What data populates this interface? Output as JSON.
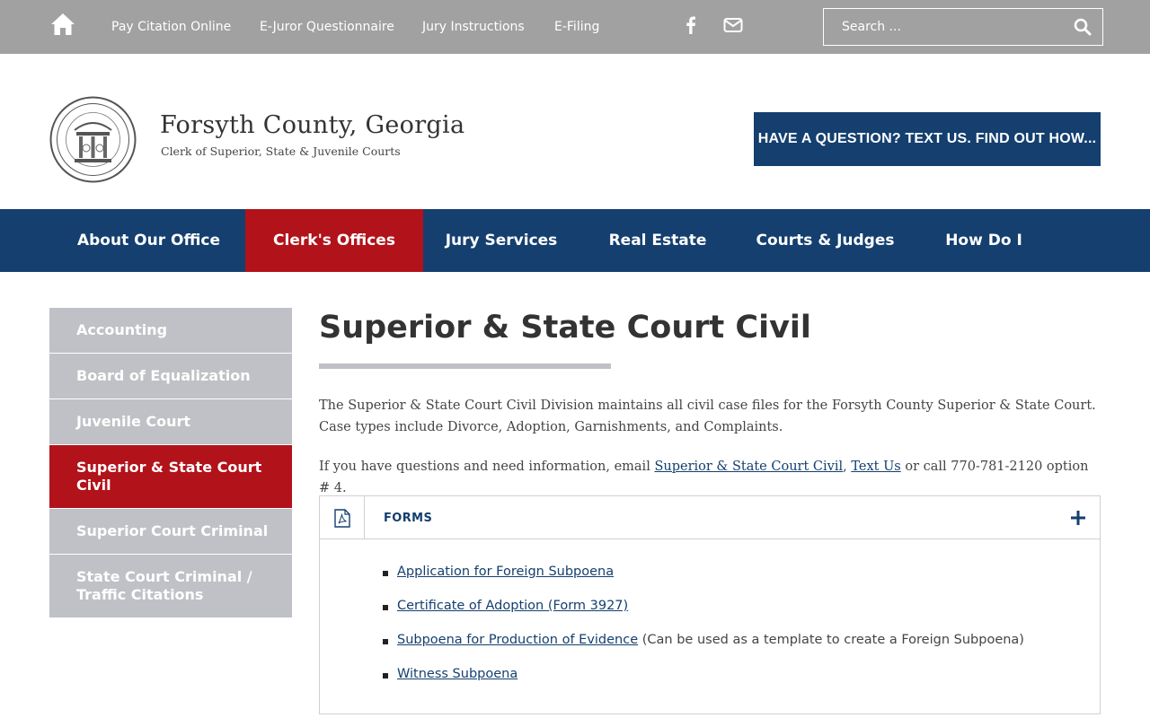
{
  "topbar": {
    "links": [
      {
        "label": "Pay Citation Online"
      },
      {
        "label": "E-Juror Questionnaire"
      },
      {
        "label": "Jury Instructions"
      },
      {
        "label": "E-Filing"
      }
    ],
    "icons": {
      "home": "home-icon",
      "facebook": "facebook-icon",
      "email": "envelope-icon",
      "search": "search-icon"
    },
    "search": {
      "placeholder": "Search ..."
    }
  },
  "header": {
    "seal_icon": "state-seal-icon",
    "title": "Forsyth County, Georgia",
    "subtitle": "Clerk of Superior, State & Juvenile Courts",
    "cta": "HAVE A QUESTION? TEXT US. FIND OUT HOW..."
  },
  "mainnav": {
    "items": [
      {
        "label": "About Our Office"
      },
      {
        "label": "Clerk's Offices",
        "active": true
      },
      {
        "label": "Jury Services"
      },
      {
        "label": "Real Estate"
      },
      {
        "label": "Courts & Judges"
      },
      {
        "label": "How Do I"
      }
    ]
  },
  "sidebar": {
    "items": [
      {
        "label": "Accounting"
      },
      {
        "label": "Board of Equalization"
      },
      {
        "label": "Juvenile Court"
      },
      {
        "label": "Superior & State Court Civil",
        "active": true
      },
      {
        "label": "Superior Court Criminal"
      },
      {
        "label": "State Court Criminal / Traffic Citations"
      }
    ]
  },
  "content": {
    "title": "Superior & State Court Civil",
    "intro": "The Superior & State Court Civil Division maintains all civil case files for the Forsyth County Superior & State Court. Case types include Divorce, Adoption, Garnishments, and Complaints.",
    "contact": {
      "prefix": "If you have questions and need information, email ",
      "email_link": "Superior & State Court Civil",
      "comma": ", ",
      "text_link": "Text Us",
      "suffix": " or call 770-781-2120 option # 4."
    },
    "accordion": {
      "icon": "pdf-file-icon",
      "title": "FORMS",
      "toggle_icon": "plus-icon",
      "items": [
        {
          "link": "Application for Foreign Subpoena",
          "note": ""
        },
        {
          "link": "Certificate of Adoption (Form 3927)",
          "note": ""
        },
        {
          "link": "Subpoena for Production of Evidence",
          "note": " (Can be used as a template to create a Foreign Subpoena)"
        },
        {
          "link": "Witness Subpoena",
          "note": ""
        }
      ]
    }
  },
  "colors": {
    "navy": "#143f6f",
    "red": "#b2121a",
    "topbar": "#a1a1a1",
    "sidebar": "#c0c1c6"
  }
}
